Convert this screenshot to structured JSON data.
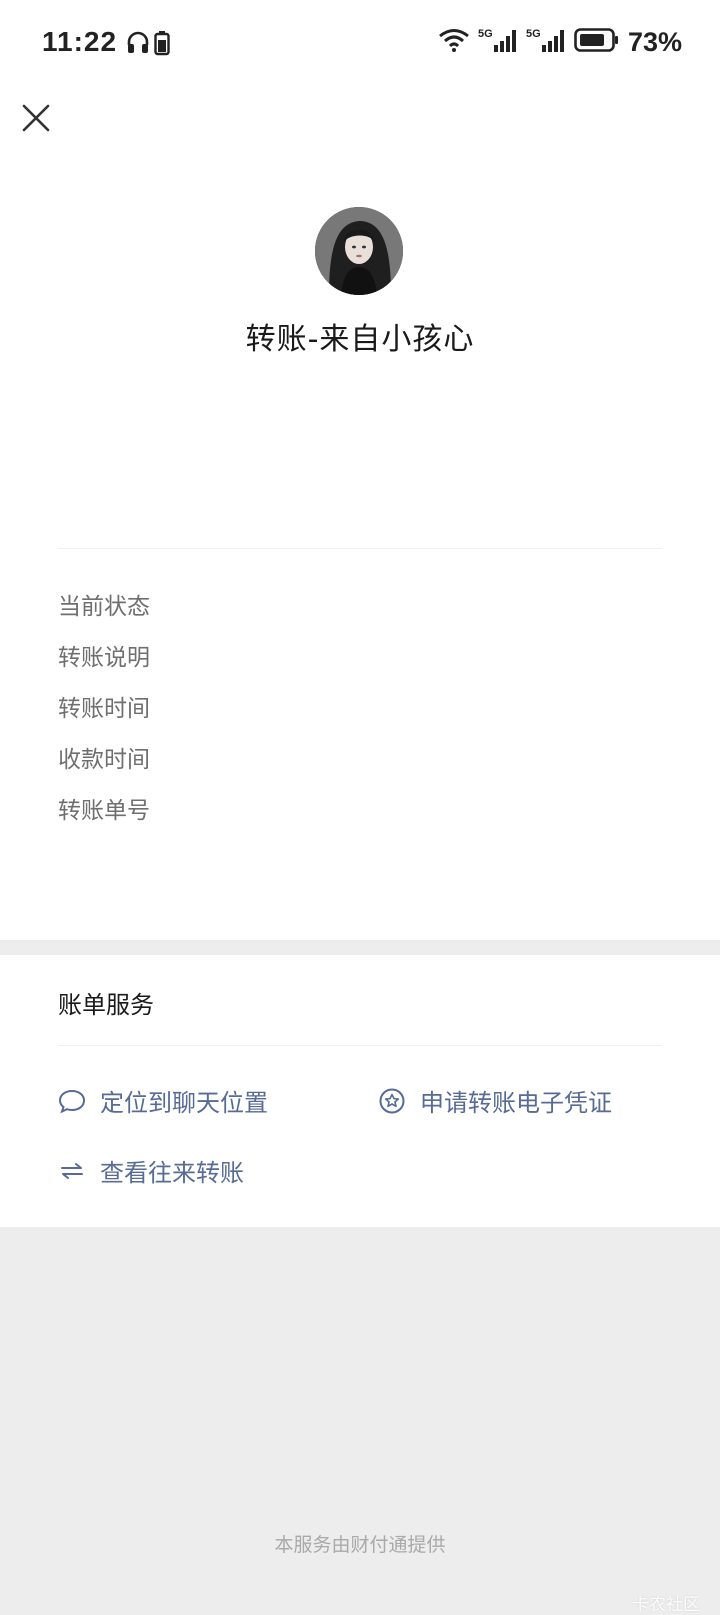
{
  "status_bar": {
    "time": "11:22",
    "battery": "73%",
    "network_left": "5G",
    "network_right": "5G",
    "icons": [
      "headphones-icon",
      "battery-small-icon",
      "wifi-icon",
      "signal-5g-icon",
      "signal-5g-icon",
      "battery-icon"
    ]
  },
  "header": {
    "close_icon": "close-icon"
  },
  "transfer": {
    "title": "转账-来自小孩心"
  },
  "details": {
    "labels": [
      "当前状态",
      "转账说明",
      "转账时间",
      "收款时间",
      "转账单号"
    ]
  },
  "services": {
    "title": "账单服务",
    "items": [
      {
        "label": "定位到聊天位置",
        "icon": "chat-bubble-icon"
      },
      {
        "label": "申请转账电子凭证",
        "icon": "badge-star-icon"
      },
      {
        "label": "查看往来转账",
        "icon": "exchange-arrows-icon"
      }
    ]
  },
  "footer": {
    "provider": "本服务由财付通提供",
    "watermark": "卡农社区"
  },
  "colors": {
    "link": "#576b95",
    "background": "#ededed",
    "card": "#ffffff",
    "label": "#6f6f6f"
  }
}
